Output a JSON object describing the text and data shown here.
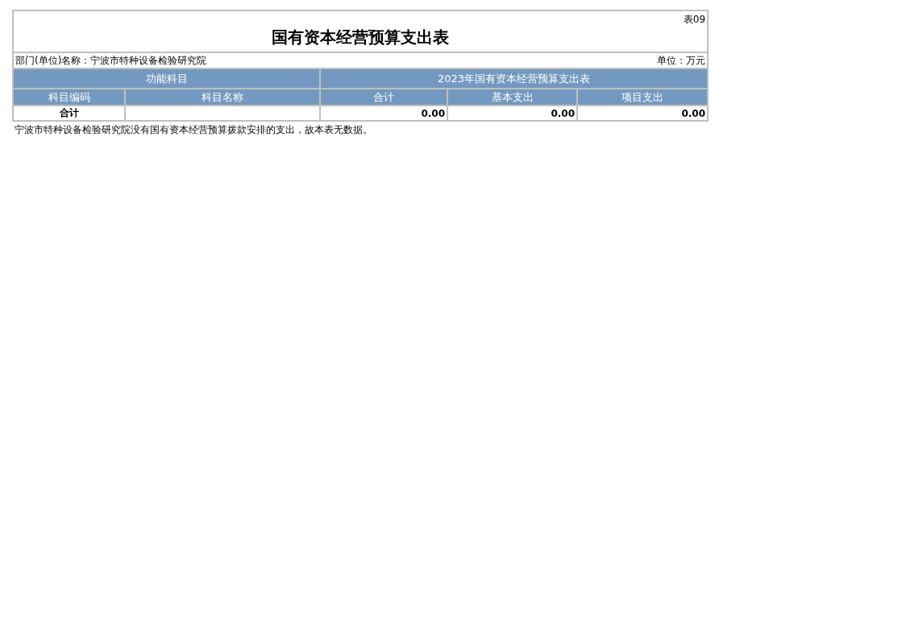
{
  "table_no": "表09",
  "title": "国有资本经营预算支出表",
  "department": "部门(单位)名称：宁波市特种设备检验研究院",
  "unit": "单位：万元",
  "group_headers": [
    "功能科目",
    "2023年国有资本经营预算支出表"
  ],
  "columns": [
    "科目编码",
    "科目名称",
    "合计",
    "基本支出",
    "项目支出"
  ],
  "rows": [
    {
      "cells": [
        "合计",
        "",
        "0.00",
        "0.00",
        "0.00"
      ]
    }
  ],
  "note": "宁波市特种设备检验研究院没有国有资本经营预算拨款安排的支出，故本表无数据。"
}
